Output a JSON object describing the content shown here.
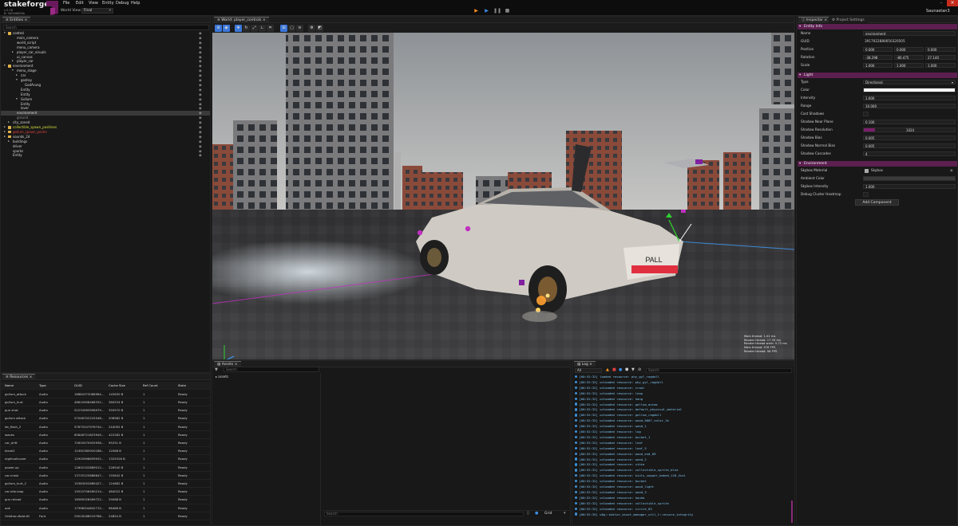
{
  "app": {
    "brand": "stakeforge",
    "version_line1": "v 0.18",
    "version_line2": "B: 5bf9d6856b",
    "user": "Saunastan3",
    "menus": [
      "File",
      "Edit",
      "View",
      "Entity",
      "Debug",
      "Help"
    ],
    "world_view_label": "World View",
    "world_view_value": "Final"
  },
  "entities": {
    "tab": "Entities",
    "search_placeholder": "Search",
    "items": [
      {
        "label": "control",
        "depth": 0,
        "folder": true,
        "expanded": true,
        "color": "#e6e6e6",
        "eye": true
      },
      {
        "label": "main_camera",
        "depth": 2,
        "eye": true
      },
      {
        "label": "world_script",
        "depth": 2,
        "eye": true
      },
      {
        "label": "menu_camera",
        "depth": 2,
        "eye": true
      },
      {
        "label": "player_car_visuals",
        "depth": 2,
        "arrow": true,
        "eye": true
      },
      {
        "label": "ui_canvas",
        "depth": 2,
        "eye": true
      },
      {
        "label": "player_car",
        "depth": 2,
        "arrow": true,
        "eye": true
      },
      {
        "label": "environment",
        "depth": 0,
        "folder": true,
        "expanded": true,
        "eye": true
      },
      {
        "label": "menu_stage",
        "depth": 2,
        "expanded": true,
        "eye": true
      },
      {
        "label": "car",
        "depth": 3,
        "arrow": true,
        "eye": true
      },
      {
        "label": "godray",
        "depth": 3,
        "expanded": true,
        "eye": true
      },
      {
        "label": "GodArung",
        "depth": 4,
        "eye": true
      },
      {
        "label": "Entity",
        "depth": 3,
        "eye": true
      },
      {
        "label": "Entity",
        "depth": 3,
        "eye": true
      },
      {
        "label": "Gollum",
        "depth": 3,
        "expanded": true,
        "eye": true
      },
      {
        "label": "Entity",
        "depth": 3,
        "eye": true
      },
      {
        "label": "lover",
        "depth": 3,
        "eye": true
      },
      {
        "label": "environment",
        "depth": 2,
        "selected": true,
        "eye": true
      },
      {
        "label": "ground",
        "depth": 2,
        "color": "#8a8a8a",
        "eye": true
      },
      {
        "label": "city_zoned",
        "depth": 1,
        "arrow": true,
        "eye": true
      },
      {
        "label": "collectible_spawn_positions",
        "depth": 0,
        "folder": true,
        "arrow": true,
        "color": "#d5e23a",
        "eye": true
      },
      {
        "label": "gollum_spawn_points",
        "depth": 0,
        "folder": true,
        "arrow": true,
        "color": "#e04040",
        "eye": true
      },
      {
        "label": "sounds_2d",
        "depth": 0,
        "folder": true,
        "arrow": true,
        "eye": true
      },
      {
        "label": "buildings",
        "depth": 1,
        "arrow": true,
        "eye": true
      },
      {
        "label": "driver",
        "depth": 1,
        "eye": true
      },
      {
        "label": "sparks",
        "depth": 1,
        "eye": true
      },
      {
        "label": "Entity",
        "depth": 1,
        "eye": true
      }
    ]
  },
  "resources": {
    "tab": "Resources",
    "columns": [
      "Name",
      "Type",
      "GUID",
      "Cache Size",
      "Ref Count",
      "State"
    ],
    "rows": [
      [
        "gollum_attack",
        "Audio",
        "18884373068984…",
        "145630 B",
        "1",
        "Ready"
      ],
      [
        "gollum_hurt",
        "Audio",
        "46810908468332…",
        "380534 B",
        "1",
        "Ready"
      ],
      [
        "gun shot",
        "Audio",
        "52234563958979…",
        "350570 B",
        "1",
        "Ready"
      ],
      [
        "gollum attack",
        "Audio",
        "57048702225548…",
        "208982 B",
        "1",
        "Ready"
      ],
      [
        "lot_flash_2",
        "Audio",
        "57875247976744…",
        "244092 B",
        "1",
        "Ready"
      ],
      [
        "waves",
        "Audio",
        "65848721823949…",
        "422282 B",
        "1",
        "Ready"
      ],
      [
        "car_drift",
        "Audio",
        "72620570925938…",
        "95251 B",
        "1",
        "Ready"
      ],
      [
        "klank2",
        "Audio",
        "12492385920188…",
        "12066 B",
        "1",
        "Ready"
      ],
      [
        "nightcallcover",
        "Audio",
        "12920998839932…",
        "1325326 B",
        "1",
        "Ready"
      ],
      [
        "power-up",
        "Audio",
        "12802152889012…",
        "226540 B",
        "1",
        "Ready"
      ],
      [
        "car-crash",
        "Audio",
        "13733125886647…",
        "155642 B",
        "1",
        "Ready"
      ],
      [
        "gollum_hurt_2",
        "Audio",
        "15363052689427…",
        "124682 B",
        "1",
        "Ready"
      ],
      [
        "car-idle-loop",
        "Audio",
        "15515706490214…",
        "484022 B",
        "1",
        "Ready"
      ],
      [
        "gun reload",
        "Audio",
        "16569328469722…",
        "29068 B",
        "1",
        "Ready"
      ],
      [
        "ook",
        "Audio",
        "17398344842715…",
        "96486 B",
        "1",
        "Ready"
      ],
      [
        "Orbitron-Bold.ttf",
        "Font",
        "29018188519768…",
        "24854 B",
        "1",
        "Ready"
      ]
    ]
  },
  "viewport": {
    "tab": "World: player_controls",
    "stats": [
      "Main thread: 1.02 ms",
      "Render thread: 17.35 ms",
      "Render thread work: 5.72 ms",
      "Main thread: 978 FPS",
      "Render thread: 58 FPS"
    ],
    "plate": "PALL"
  },
  "inspector": {
    "tab": "Inspector",
    "tab2": "Project Settings",
    "entity_section": "Entity Info",
    "name_label": "Name",
    "name_value": "environment",
    "guid_label": "GUID",
    "guid_value": "3917922880650320505",
    "position_label": "Position",
    "position": [
      "0.000",
      "0.000",
      "0.000"
    ],
    "rotation_label": "Rotation",
    "rotation": [
      "-38.298",
      "-80.475",
      "27.140"
    ],
    "scale_label": "Scale",
    "scale": [
      "1.000",
      "1.000",
      "1.000"
    ],
    "light_section": "Light",
    "type_label": "Type",
    "type_value": "Directional",
    "color_label": "Color",
    "intensity_label": "Intensity",
    "intensity_value": "1.600",
    "range_label": "Range",
    "range_value": "10.000",
    "cast_shadows_label": "Cast Shadows",
    "shadow_near_label": "Shadow Near Plane",
    "shadow_near_value": "0.100",
    "shadow_res_label": "Shadow Resolution",
    "shadow_res_value": "1024",
    "shadow_bias_label": "Shadow Bias",
    "shadow_bias_value": "0.005",
    "shadow_normal_label": "Shadow Normal Bias",
    "shadow_normal_value": "0.005",
    "shadow_cascades_label": "Shadow Cascades",
    "shadow_cascades_value": "4",
    "env_section": "Environment",
    "skybox_label": "Skybox Material",
    "skybox_value": "Skybox",
    "ambient_label": "Ambient Color",
    "sky_int_label": "Skybox Intensity",
    "sky_int_value": "1.000",
    "debug_label": "Debug Cluster Heatmap",
    "add_component": "Add Component"
  },
  "assets": {
    "tab": "Assets",
    "search_placeholder": "Search",
    "root": "assets",
    "foot_search": "Search",
    "view_mode": "Grid"
  },
  "log": {
    "tab": "Log",
    "filter": "All",
    "search_placeholder": "Search",
    "lines": [
      "[00:52:32] loaded resource: phy_gyl_ragdoll",
      "[00:52:32] unloaded resource: phy_gyl_ragdoll",
      "[00:52:32] unloaded resource: crawl",
      "[00:52:32] unloaded resource: leap",
      "[00:52:32] unloaded resource: hang",
      "[00:52:32] unloaded resource: gollum_anims",
      "[00:52:32] unloaded resource: default_physical_material",
      "[00:52:32] unloaded resource: gollum_ragdoll",
      "[00:52:32] unloaded resource: wood_0007_color_1k",
      "[00:52:32] unloaded resource: wood_1",
      "[00:52:32] unloaded resource: log",
      "[00:52:32] unloaded resource: bucket_1",
      "[00:52:32] unloaded resource: leaf",
      "[00:52:32] unloaded resource: leaf_5",
      "[00:52:32] unloaded resource: wood_end_09",
      "[00:52:32] unloaded resource: wood_2",
      "[00:52:32] unloaded resource: vihta",
      "[00:52:32] unloaded resource: collectible_sprite_blue",
      "[00:52:32] unloaded resource: kiulu_copper_baked_128_4col",
      "[00:52:32] unloaded resource: bucket",
      "[00:52:32] unloaded resource: wood_light",
      "[00:52:32] unloaded resource: wood_3",
      "[00:52:32] unloaded resource: kauha",
      "[00:52:32] unloaded resource: collectible_sprite",
      "[00:52:32] unloaded resource: circle_03",
      "[00:52:35] u6g::editor_asset_manager_util_t::ensure_integrity"
    ]
  },
  "colors": {
    "accent_magenta": "#5c1f50",
    "selection_blue": "#3b77d9",
    "log_text": "#7ec4f0"
  }
}
